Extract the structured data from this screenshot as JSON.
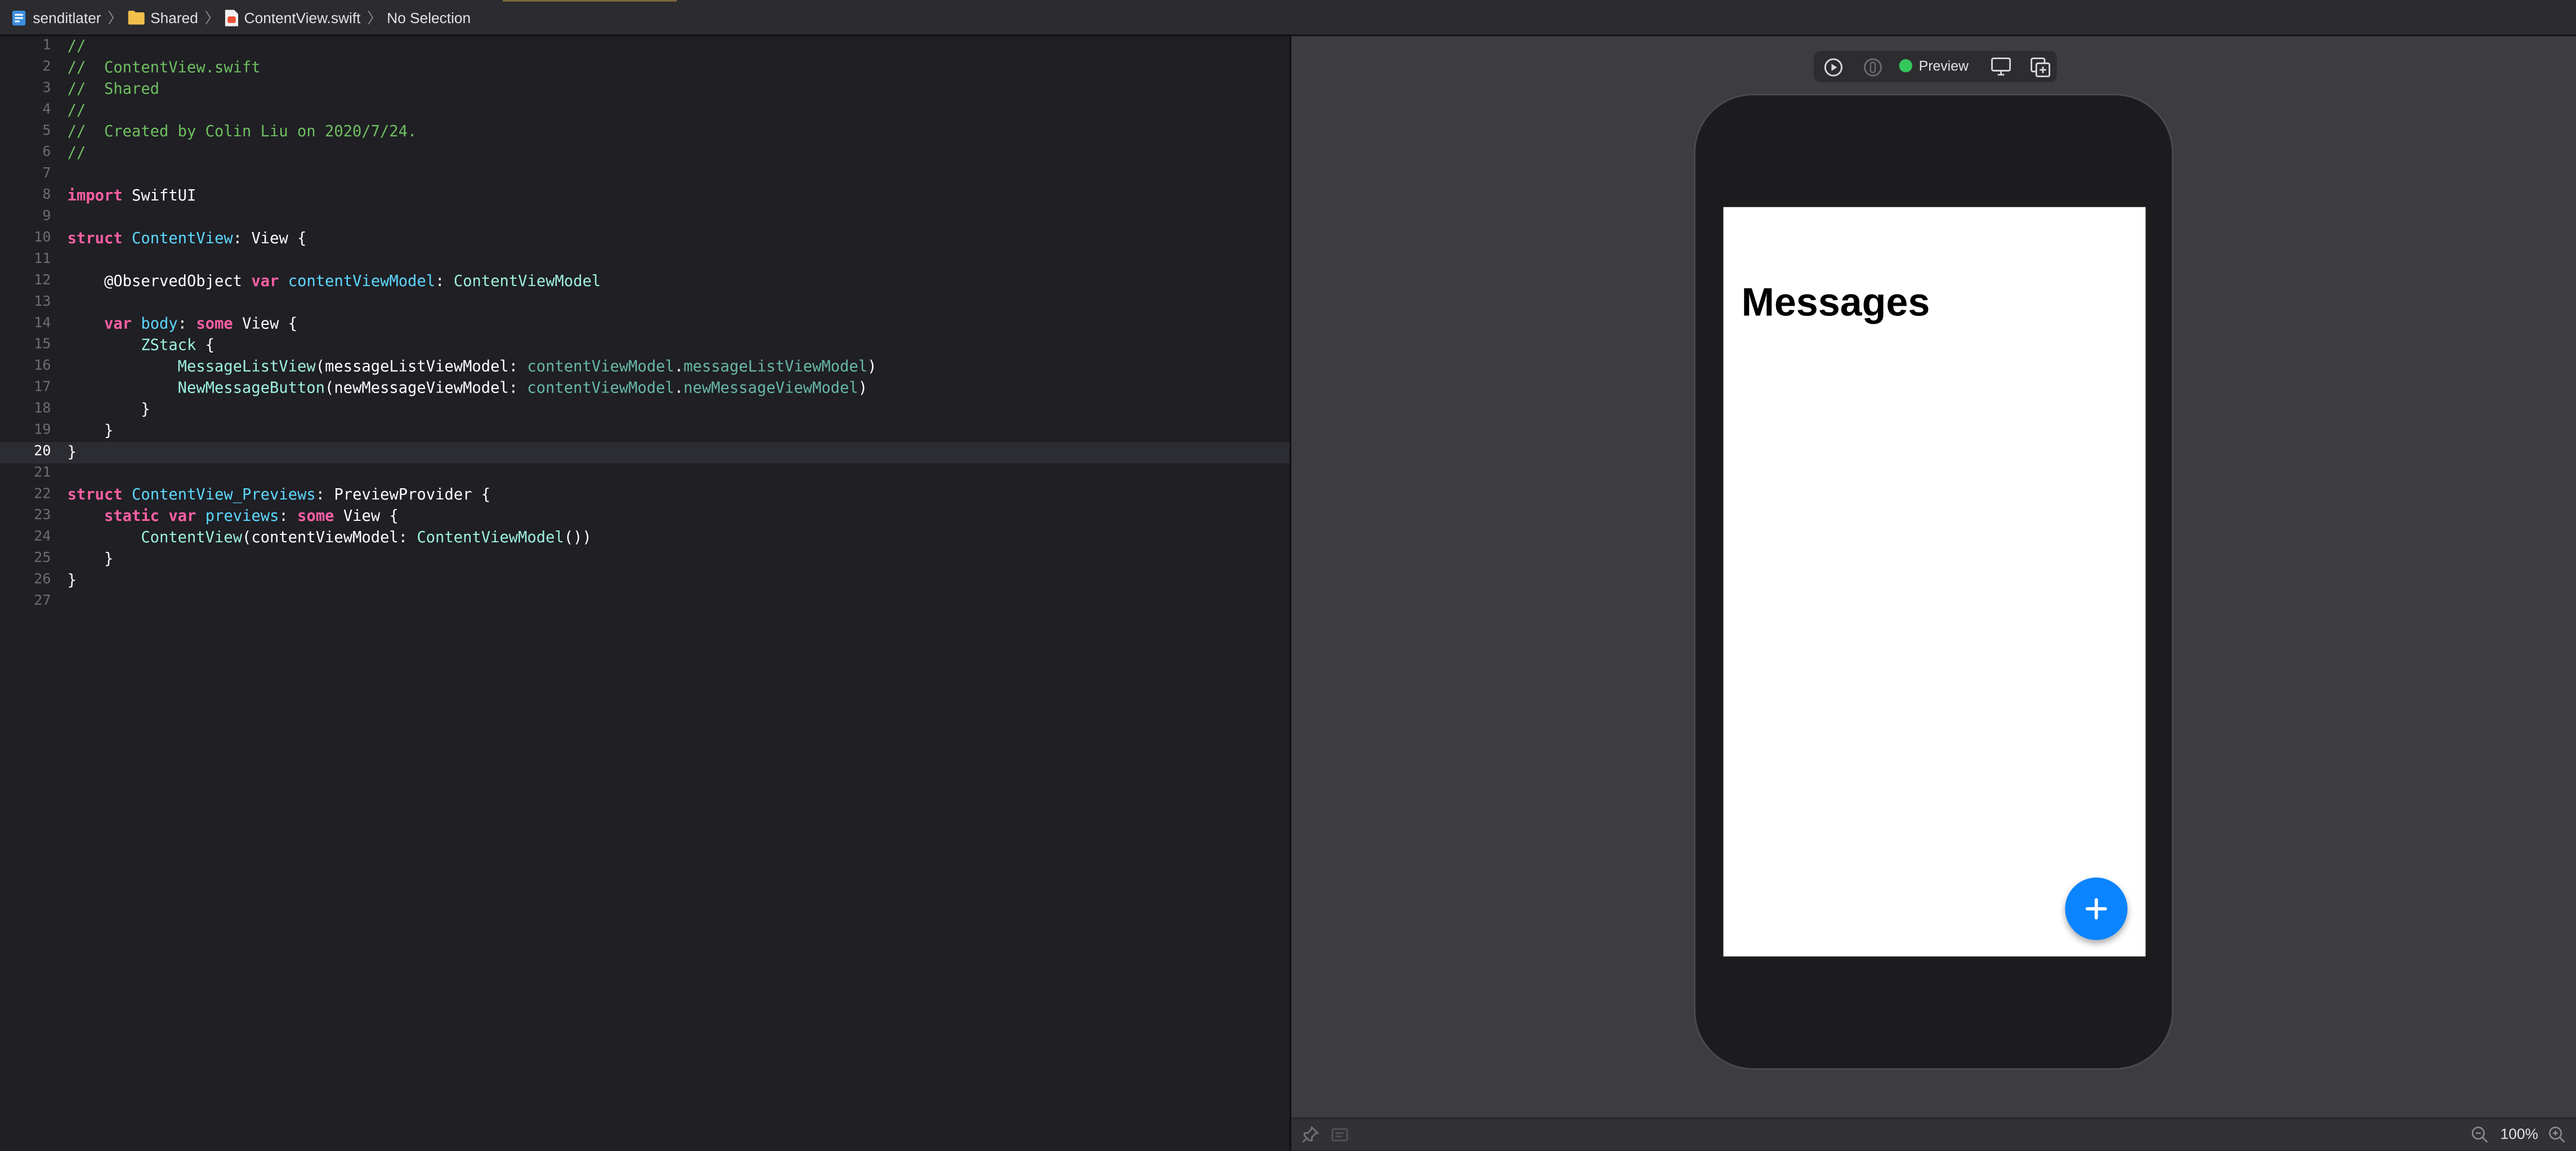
{
  "breadcrumb": {
    "project": "senditlater",
    "folder": "Shared",
    "file": "ContentView.swift",
    "selection": "No Selection"
  },
  "editor": {
    "current_line": 20,
    "line_numbers": [
      "1",
      "2",
      "3",
      "4",
      "5",
      "6",
      "7",
      "8",
      "9",
      "10",
      "11",
      "12",
      "13",
      "14",
      "15",
      "16",
      "17",
      "18",
      "19",
      "20",
      "21",
      "22",
      "23",
      "24",
      "25",
      "26",
      "27"
    ],
    "lines": {
      "l1": "//",
      "l2": "//  ContentView.swift",
      "l3": "//  Shared",
      "l4": "//",
      "l5": "//  Created by Colin Liu on 2020/7/24.",
      "l6": "//",
      "l8_kw": "import",
      "l8_rest": " SwiftUI",
      "l10_kw": "struct",
      "l10_name": "ContentView",
      "l10_rest": ": View {",
      "l12_attr": "@ObservedObject",
      "l12_kw": "var",
      "l12_name": "contentViewModel",
      "l12_sep": ": ",
      "l12_type": "ContentViewModel",
      "l14_kw": "var",
      "l14_name": "body",
      "l14_sep": ": ",
      "l14_kw2": "some",
      "l14_rest": " View {",
      "l15_type": "ZStack",
      "l15_rest": " {",
      "l16_type": "MessageListView",
      "l16_a": "(messageListViewModel: ",
      "l16_p1": "contentViewModel",
      "l16_dot": ".",
      "l16_p2": "messageListViewModel",
      "l16_end": ")",
      "l17_type": "NewMessageButton",
      "l17_a": "(newMessageViewModel: ",
      "l17_p1": "contentViewModel",
      "l17_dot": ".",
      "l17_p2": "newMessageViewModel",
      "l17_end": ")",
      "l18": "}",
      "l19": "}",
      "l20": "}",
      "l22_kw": "struct",
      "l22_name": "ContentView_Previews",
      "l22_sep": ": ",
      "l22_rest": "PreviewProvider {",
      "l23_kw": "static",
      "l23_kw2": "var",
      "l23_name": "previews",
      "l23_sep": ": ",
      "l23_kw3": "some",
      "l23_rest": " View {",
      "l24_type": "ContentView",
      "l24_a": "(contentViewModel: ",
      "l24_type2": "ContentViewModel",
      "l24_end": "())",
      "l25": "}",
      "l26": "}"
    }
  },
  "preview": {
    "toolbar_label": "Preview",
    "status_color": "#35c759",
    "screen_title": "Messages",
    "fab_icon": "plus-icon",
    "fab_color": "#0a84ff"
  },
  "canvas_footer": {
    "zoom_level": "100%"
  }
}
